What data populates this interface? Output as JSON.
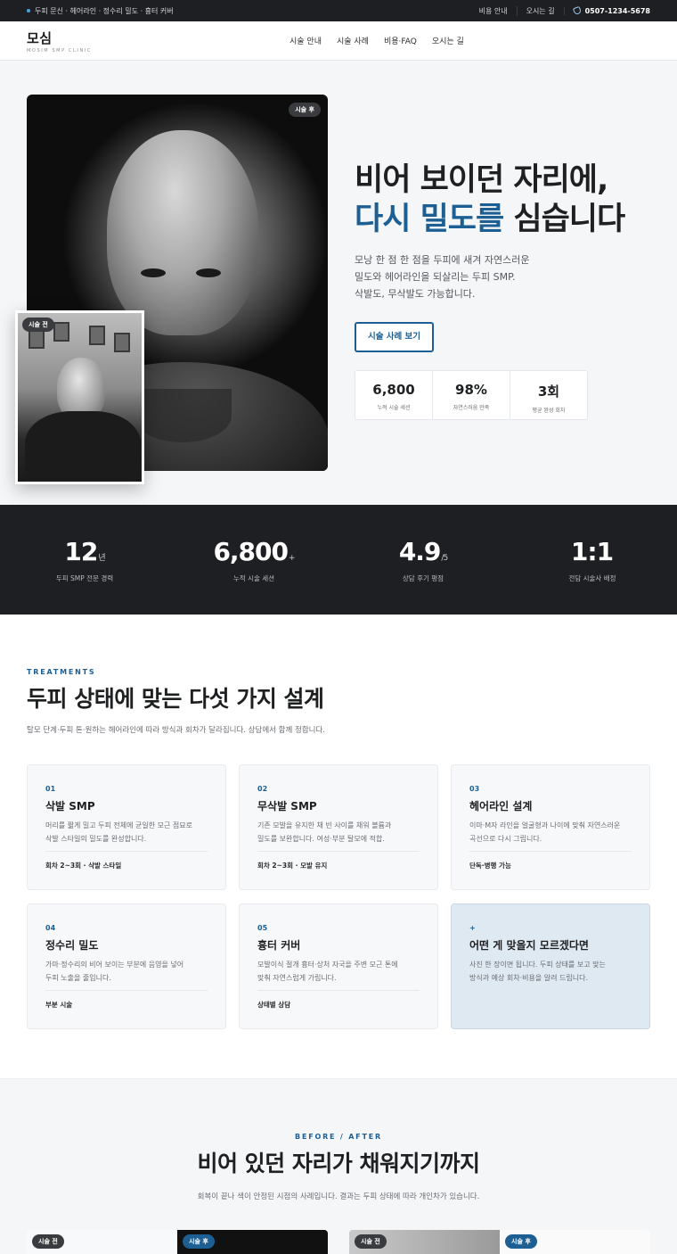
{
  "topbar": {
    "note": "두피 문신 · 헤어라인 · 정수리 밀도 · 흉터 커버",
    "links": [
      "비용 안내",
      "오시는 길"
    ],
    "phone": "0507-1234-5678"
  },
  "header": {
    "logo_name": "모심",
    "logo_sub": "MOSIM SMP CLINIC",
    "nav": [
      "시술 안내",
      "시술 사례",
      "비용·FAQ",
      "오시는 길"
    ]
  },
  "hero": {
    "after_badge": "시술 후",
    "before_badge": "시술 전",
    "title_line1": "비어 보이던 자리에,",
    "title_accent": "다시 밀도를",
    "title_rest": " 심습니다",
    "desc": [
      "모낭 한 점 한 점을 두피에 새겨 자연스러운",
      "밀도와 헤어라인을 되살리는 두피 SMP.",
      "삭발도, 무삭발도 가능합니다."
    ],
    "cta": "시술 사례 보기",
    "mini_stats": [
      {
        "num": "6,800",
        "label": "누적 시술 세션"
      },
      {
        "num": "98%",
        "label": "자연스러움 만족"
      },
      {
        "num": "3회",
        "label": "평균 완성 회차"
      }
    ]
  },
  "stats": [
    {
      "num": "12",
      "unit": "년",
      "label": "두피 SMP 전문 경력"
    },
    {
      "num": "6,800",
      "unit": "+",
      "label": "누적 시술 세션"
    },
    {
      "num": "4.9",
      "unit": "/5",
      "label": "상담 후기 평점"
    },
    {
      "num": "1:1",
      "unit": "",
      "label": "전담 시술사 배정"
    }
  ],
  "treatments": {
    "eyebrow": "TREATMENTS",
    "title": "두피 상태에 맞는 다섯 가지 설계",
    "desc": "탈모 단계·두피 톤·원하는 헤어라인에 따라 방식과 회차가 달라집니다. 상담에서 함께 정합니다.",
    "cards": [
      {
        "no": "01",
        "title": "삭발 SMP",
        "text": [
          "머리를 짧게 밀고 두피 전체에 균일한 모근 점묘로",
          "삭발 스타일의 밀도를 완성합니다."
        ],
        "foot": "회차 2~3회 · 삭발 스타일"
      },
      {
        "no": "02",
        "title": "무삭발 SMP",
        "text": [
          "기존 모발을 유지한 채 빈 사이를 채워 볼륨과",
          "밀도를 보완합니다. 여성·부분 탈모에 적합."
        ],
        "foot": "회차 2~3회 · 모발 유지"
      },
      {
        "no": "03",
        "title": "헤어라인 설계",
        "text": [
          "이마·M자 라인을 얼굴형과 나이에 맞춰 자연스러운",
          "곡선으로 다시 그립니다."
        ],
        "foot": "단독·병행 가능"
      },
      {
        "no": "04",
        "title": "정수리 밀도",
        "text": [
          "가마·정수리의 비어 보이는 부분에 음영을 넣어",
          "두피 노출을 줄입니다."
        ],
        "foot": "부분 시술"
      },
      {
        "no": "05",
        "title": "흉터 커버",
        "text": [
          "모발이식 절개 흉터·상처 자국을 주변 모근 톤에",
          "맞춰 자연스럽게 가립니다."
        ],
        "foot": "상태별 상담"
      },
      {
        "no": "+",
        "title": "어떤 게 맞을지 모르겠다면",
        "text": [
          "사진 한 장이면 됩니다. 두피 상태를 보고 맞는",
          "방식과 예상 회차·비용을 알려 드립니다."
        ],
        "foot": ""
      }
    ]
  },
  "before_after": {
    "eyebrow": "BEFORE / AFTER",
    "title": "비어 있던 자리가 채워지기까지",
    "desc": "회복이 끝나 색이 안정된 시점의 사례입니다. 결과는 두피 상태에 따라 개인차가 있습니다.",
    "before_badge": "시술 전",
    "after_badge": "시술 후"
  },
  "colors": {
    "accent": "#1d5f93",
    "dark": "#1e1f22",
    "card_alt": "#dfe9f1"
  }
}
